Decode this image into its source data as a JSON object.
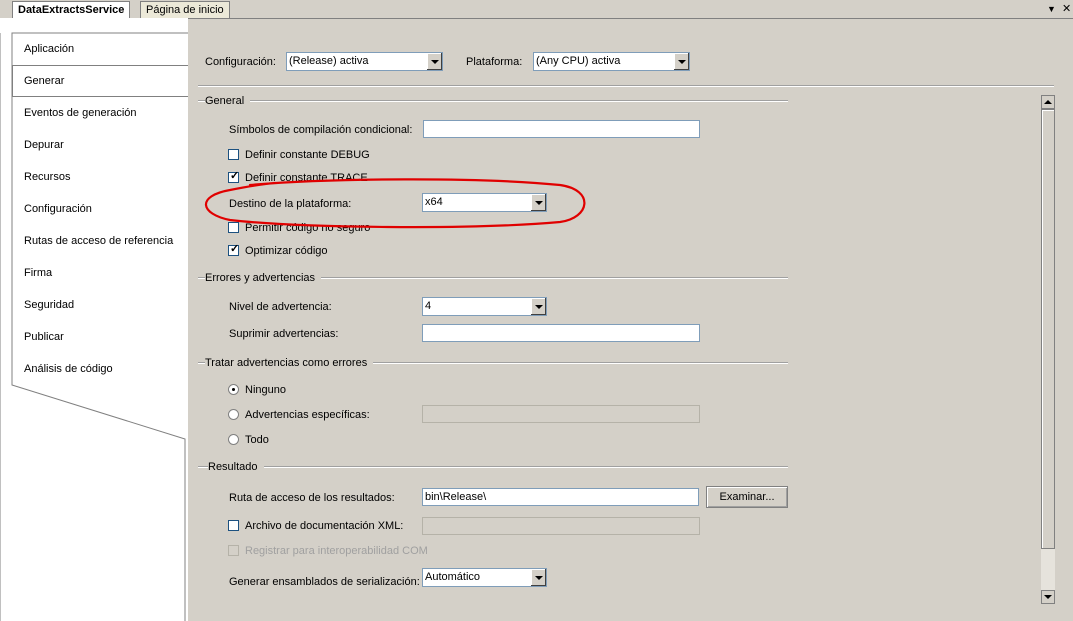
{
  "doc_tabs": [
    {
      "label": "DataExtractsService",
      "active": true
    },
    {
      "label": "Página de inicio",
      "active": false
    }
  ],
  "window_controls": {
    "dropdown_glyph": "▼",
    "close_glyph": "✕"
  },
  "nav_items": [
    {
      "label": "Aplicación"
    },
    {
      "label": "Generar",
      "selected": true
    },
    {
      "label": "Eventos de generación"
    },
    {
      "label": "Depurar"
    },
    {
      "label": "Recursos"
    },
    {
      "label": "Configuración"
    },
    {
      "label": "Rutas de acceso de referencia"
    },
    {
      "label": "Firma"
    },
    {
      "label": "Seguridad"
    },
    {
      "label": "Publicar"
    },
    {
      "label": "Análisis de código"
    }
  ],
  "config_bar": {
    "configuration_label": "Configuración:",
    "configuration_value": "(Release) activa",
    "platform_label": "Plataforma:",
    "platform_value": "(Any CPU) activa"
  },
  "general": {
    "title": "General",
    "symbols_label": "Símbolos de compilación condicional:",
    "symbols_value": "",
    "debug_label": "Definir constante DEBUG",
    "debug_checked": false,
    "trace_label": "Definir constante TRACE",
    "trace_checked": true,
    "platform_target_label": "Destino de la plataforma:",
    "platform_target_value": "x64",
    "unsafe_label": "Permitir código no seguro",
    "unsafe_checked": false,
    "optimize_label": "Optimizar código",
    "optimize_checked": true
  },
  "errors": {
    "title": "Errores y advertencias",
    "warning_level_label": "Nivel de advertencia:",
    "warning_level_value": "4",
    "suppress_label": "Suprimir advertencias:",
    "suppress_value": ""
  },
  "treat_warnings": {
    "title": "Tratar advertencias como errores",
    "none_label": "Ninguno",
    "specific_label": "Advertencias específicas:",
    "specific_value": "",
    "all_label": "Todo",
    "selected": "none"
  },
  "output": {
    "title": "Resultado",
    "path_label": "Ruta de acceso de los resultados:",
    "path_value": "bin\\Release\\",
    "browse_label": "Examinar...",
    "xml_doc_label": "Archivo de documentación XML:",
    "xml_doc_checked": false,
    "xml_doc_value": "",
    "com_label": "Registrar para interoperabilidad COM",
    "com_checked": false,
    "serialization_label": "Generar ensamblados de serialización:",
    "serialization_value": "Automático"
  },
  "annotation_color": "#e00000",
  "accent_tab_border": "#808080"
}
